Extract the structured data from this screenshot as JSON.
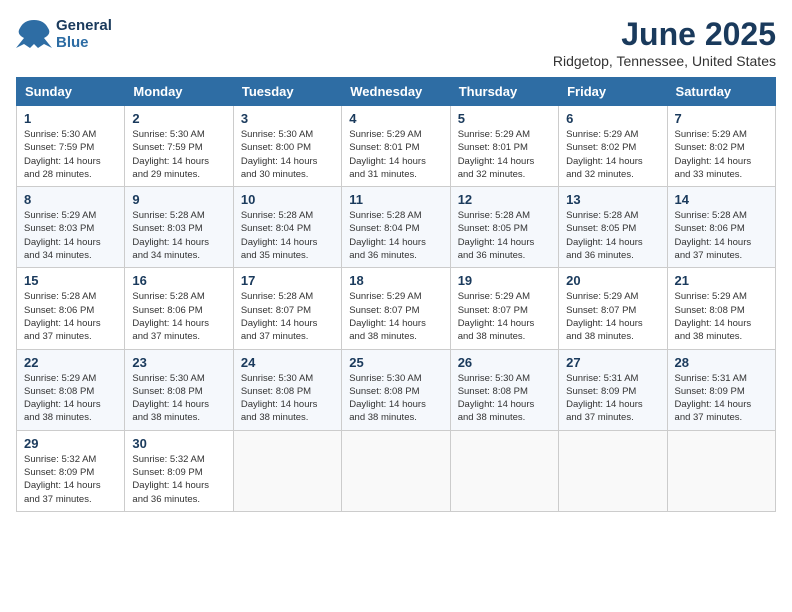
{
  "header": {
    "logo_line1": "General",
    "logo_line2": "Blue",
    "month_title": "June 2025",
    "location": "Ridgetop, Tennessee, United States"
  },
  "weekdays": [
    "Sunday",
    "Monday",
    "Tuesday",
    "Wednesday",
    "Thursday",
    "Friday",
    "Saturday"
  ],
  "weeks": [
    [
      {
        "day": "1",
        "sunrise": "5:30 AM",
        "sunset": "7:59 PM",
        "daylight": "14 hours and 28 minutes."
      },
      {
        "day": "2",
        "sunrise": "5:30 AM",
        "sunset": "7:59 PM",
        "daylight": "14 hours and 29 minutes."
      },
      {
        "day": "3",
        "sunrise": "5:30 AM",
        "sunset": "8:00 PM",
        "daylight": "14 hours and 30 minutes."
      },
      {
        "day": "4",
        "sunrise": "5:29 AM",
        "sunset": "8:01 PM",
        "daylight": "14 hours and 31 minutes."
      },
      {
        "day": "5",
        "sunrise": "5:29 AM",
        "sunset": "8:01 PM",
        "daylight": "14 hours and 32 minutes."
      },
      {
        "day": "6",
        "sunrise": "5:29 AM",
        "sunset": "8:02 PM",
        "daylight": "14 hours and 32 minutes."
      },
      {
        "day": "7",
        "sunrise": "5:29 AM",
        "sunset": "8:02 PM",
        "daylight": "14 hours and 33 minutes."
      }
    ],
    [
      {
        "day": "8",
        "sunrise": "5:29 AM",
        "sunset": "8:03 PM",
        "daylight": "14 hours and 34 minutes."
      },
      {
        "day": "9",
        "sunrise": "5:28 AM",
        "sunset": "8:03 PM",
        "daylight": "14 hours and 34 minutes."
      },
      {
        "day": "10",
        "sunrise": "5:28 AM",
        "sunset": "8:04 PM",
        "daylight": "14 hours and 35 minutes."
      },
      {
        "day": "11",
        "sunrise": "5:28 AM",
        "sunset": "8:04 PM",
        "daylight": "14 hours and 36 minutes."
      },
      {
        "day": "12",
        "sunrise": "5:28 AM",
        "sunset": "8:05 PM",
        "daylight": "14 hours and 36 minutes."
      },
      {
        "day": "13",
        "sunrise": "5:28 AM",
        "sunset": "8:05 PM",
        "daylight": "14 hours and 36 minutes."
      },
      {
        "day": "14",
        "sunrise": "5:28 AM",
        "sunset": "8:06 PM",
        "daylight": "14 hours and 37 minutes."
      }
    ],
    [
      {
        "day": "15",
        "sunrise": "5:28 AM",
        "sunset": "8:06 PM",
        "daylight": "14 hours and 37 minutes."
      },
      {
        "day": "16",
        "sunrise": "5:28 AM",
        "sunset": "8:06 PM",
        "daylight": "14 hours and 37 minutes."
      },
      {
        "day": "17",
        "sunrise": "5:28 AM",
        "sunset": "8:07 PM",
        "daylight": "14 hours and 37 minutes."
      },
      {
        "day": "18",
        "sunrise": "5:29 AM",
        "sunset": "8:07 PM",
        "daylight": "14 hours and 38 minutes."
      },
      {
        "day": "19",
        "sunrise": "5:29 AM",
        "sunset": "8:07 PM",
        "daylight": "14 hours and 38 minutes."
      },
      {
        "day": "20",
        "sunrise": "5:29 AM",
        "sunset": "8:07 PM",
        "daylight": "14 hours and 38 minutes."
      },
      {
        "day": "21",
        "sunrise": "5:29 AM",
        "sunset": "8:08 PM",
        "daylight": "14 hours and 38 minutes."
      }
    ],
    [
      {
        "day": "22",
        "sunrise": "5:29 AM",
        "sunset": "8:08 PM",
        "daylight": "14 hours and 38 minutes."
      },
      {
        "day": "23",
        "sunrise": "5:30 AM",
        "sunset": "8:08 PM",
        "daylight": "14 hours and 38 minutes."
      },
      {
        "day": "24",
        "sunrise": "5:30 AM",
        "sunset": "8:08 PM",
        "daylight": "14 hours and 38 minutes."
      },
      {
        "day": "25",
        "sunrise": "5:30 AM",
        "sunset": "8:08 PM",
        "daylight": "14 hours and 38 minutes."
      },
      {
        "day": "26",
        "sunrise": "5:30 AM",
        "sunset": "8:08 PM",
        "daylight": "14 hours and 38 minutes."
      },
      {
        "day": "27",
        "sunrise": "5:31 AM",
        "sunset": "8:09 PM",
        "daylight": "14 hours and 37 minutes."
      },
      {
        "day": "28",
        "sunrise": "5:31 AM",
        "sunset": "8:09 PM",
        "daylight": "14 hours and 37 minutes."
      }
    ],
    [
      {
        "day": "29",
        "sunrise": "5:32 AM",
        "sunset": "8:09 PM",
        "daylight": "14 hours and 37 minutes."
      },
      {
        "day": "30",
        "sunrise": "5:32 AM",
        "sunset": "8:09 PM",
        "daylight": "14 hours and 36 minutes."
      },
      null,
      null,
      null,
      null,
      null
    ]
  ]
}
